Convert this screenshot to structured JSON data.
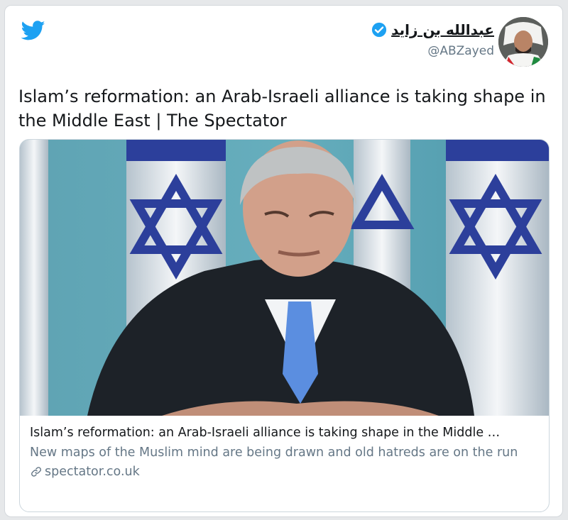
{
  "author": {
    "display_name": "عبدالله بن زايد",
    "handle": "@ABZayed",
    "verified": true
  },
  "tweet": {
    "text": "Islam’s reformation: an Arab-Israeli alliance is taking shape in the Middle East | The Spectator"
  },
  "card": {
    "title": "Islam’s reformation: an Arab-Israeli alliance is taking shape in the Middle …",
    "description": "New maps of the Muslim mind are being drawn and old hatreds are on the run",
    "domain": "spectator.co.uk"
  },
  "icons": {
    "brand": "twitter-bird-icon",
    "verified": "verified-badge-icon",
    "link": "link-icon"
  },
  "colors": {
    "brand_blue": "#1da1f2",
    "text": "#14171a",
    "secondary": "#657786",
    "border": "#ccd6dd"
  }
}
